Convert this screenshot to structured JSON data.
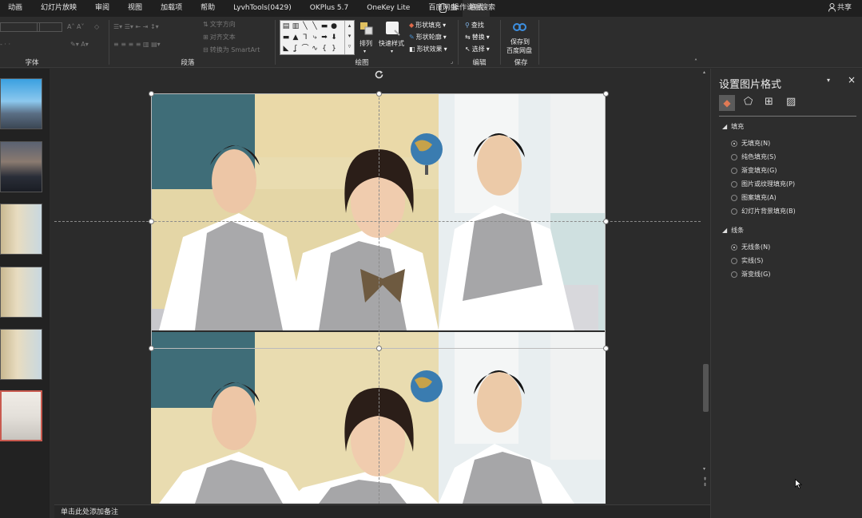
{
  "menubar": {
    "tabs": [
      "动画",
      "幻灯片放映",
      "审阅",
      "视图",
      "加载项",
      "帮助",
      "LyvhTools(0429)",
      "OKPlus 5.7",
      "OneKey Lite",
      "百度网盘",
      "格式"
    ],
    "active_tab": "格式",
    "search": "操作说明搜索",
    "share": "共享"
  },
  "ribbon": {
    "groups": {
      "font": "字体",
      "paragraph": "段落",
      "drawing": "绘图",
      "edit": "编辑",
      "save": "保存"
    },
    "buttons": {
      "text_direction": "文字方向",
      "align_text": "对齐文本",
      "smartart": "转换为 SmartArt",
      "arrange": "排列",
      "quick_styles": "快速样式",
      "shape_fill": "形状填充",
      "shape_outline": "形状轮廓",
      "shape_effects": "形状效果",
      "find": "查找",
      "replace": "替换",
      "select": "选择",
      "save_baidu_1": "保存到",
      "save_baidu_2": "百度网盘"
    }
  },
  "notes": {
    "placeholder": "单击此处添加备注"
  },
  "panel": {
    "title": "设置图片格式",
    "fill_section": "填充",
    "fill_options": [
      "无填充(N)",
      "纯色填充(S)",
      "渐变填充(G)",
      "图片或纹理填充(P)",
      "图案填充(A)",
      "幻灯片背景填充(B)"
    ],
    "fill_selected": 0,
    "line_section": "线条",
    "line_options": [
      "无线条(N)",
      "实线(S)",
      "渐变线(G)"
    ],
    "line_selected": 0
  },
  "colors": {
    "accent_selected_slide": "#c95a4f",
    "background": "#2b2b2b"
  }
}
